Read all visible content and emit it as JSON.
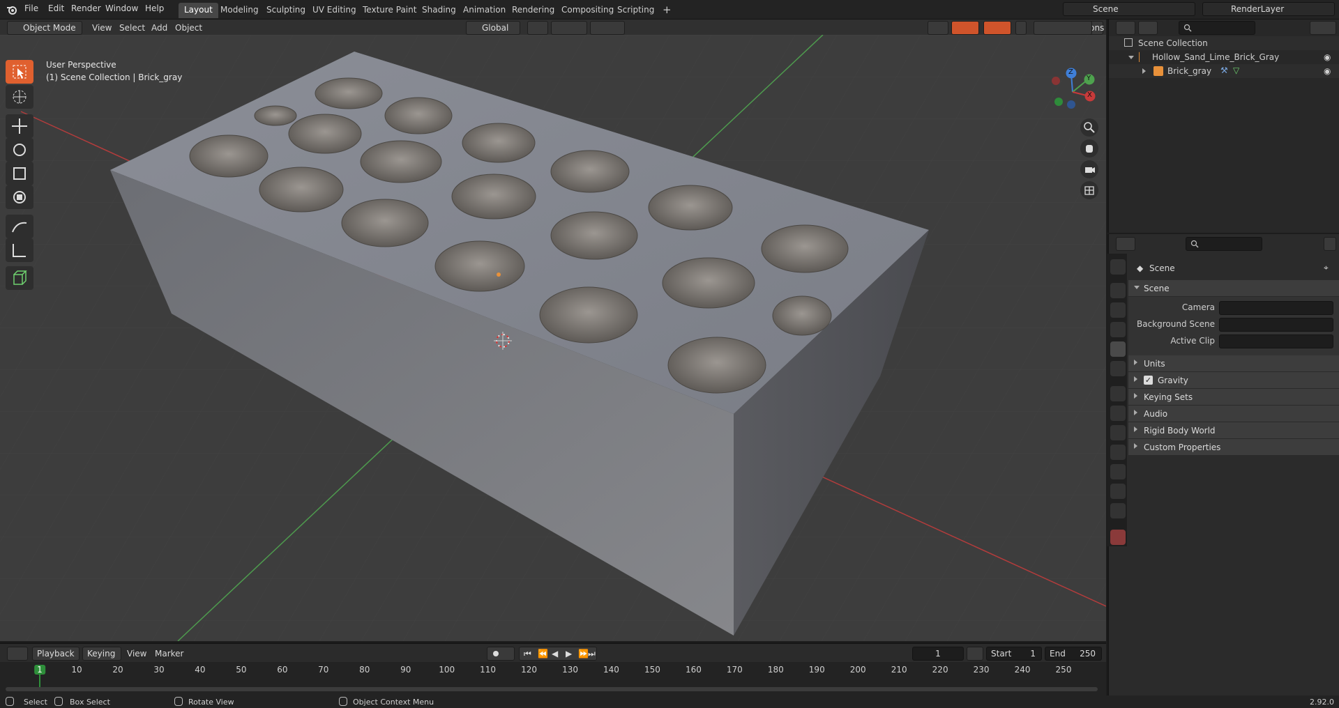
{
  "menu": [
    "File",
    "Edit",
    "Render",
    "Window",
    "Help"
  ],
  "workspaces": [
    "Layout",
    "Modeling",
    "Sculpting",
    "UV Editing",
    "Texture Paint",
    "Shading",
    "Animation",
    "Rendering",
    "Compositing",
    "Scripting"
  ],
  "scene_field": "Scene",
  "view_layer_field": "RenderLayer",
  "viewport": {
    "mode": "Object Mode",
    "menus": [
      "View",
      "Select",
      "Add",
      "Object"
    ],
    "transform_orientation": "Global",
    "options_label": "Options",
    "overlay_title": "User Perspective",
    "overlay_subtitle": "(1) Scene Collection | Brick_gray",
    "gizmo_axes": {
      "z": "Z",
      "y": "Y",
      "x": "X"
    }
  },
  "outliner": {
    "root": "Scene Collection",
    "items": [
      {
        "label": "Hollow_Sand_Lime_Brick_Gray",
        "level": 1
      },
      {
        "label": "Brick_gray",
        "level": 2
      }
    ]
  },
  "properties": {
    "context": "Scene",
    "panel": "Scene",
    "fields": [
      {
        "label": "Camera",
        "value": ""
      },
      {
        "label": "Background Scene",
        "value": ""
      },
      {
        "label": "Active Clip",
        "value": ""
      }
    ],
    "sections": [
      "Units",
      "Gravity",
      "Keying Sets",
      "Audio",
      "Rigid Body World",
      "Custom Properties"
    ],
    "gravity_checked": true
  },
  "timeline": {
    "menus": [
      "Playback",
      "Keying",
      "View",
      "Marker"
    ],
    "current_frame": "1",
    "start_label": "Start",
    "start": "1",
    "end_label": "End",
    "end": "250",
    "ticks": [
      "1",
      "10",
      "20",
      "30",
      "40",
      "50",
      "60",
      "70",
      "80",
      "90",
      "100",
      "110",
      "120",
      "130",
      "140",
      "150",
      "160",
      "170",
      "180",
      "190",
      "200",
      "210",
      "220",
      "230",
      "240",
      "250"
    ]
  },
  "statusbar": {
    "items": [
      "Select",
      "Box Select",
      "Rotate View",
      "Object Context Menu"
    ],
    "version": "2.92.0"
  },
  "colors": {
    "accent": "#e0602f",
    "axis_x": "#c83a3a",
    "axis_y": "#4ea24e",
    "frame_marker": "#2e8f3a"
  }
}
